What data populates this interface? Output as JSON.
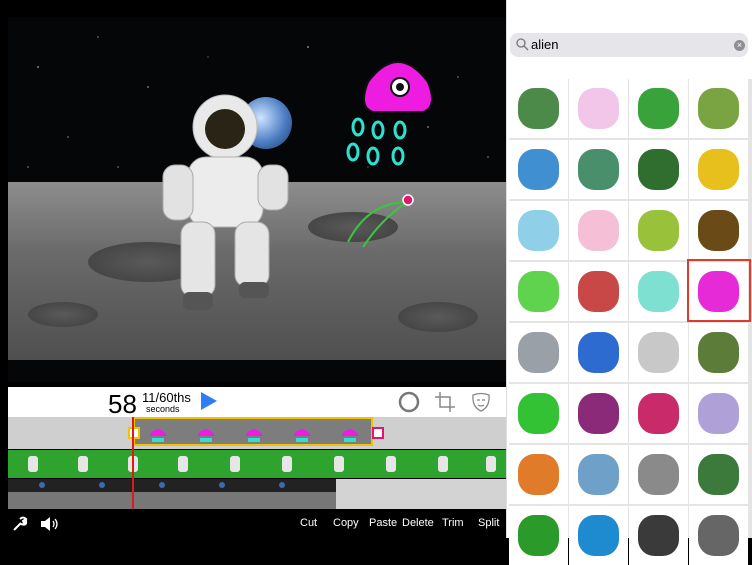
{
  "timeline": {
    "time_seconds": "58",
    "time_fraction": "11/60ths",
    "time_unit": "seconds"
  },
  "bottombar": {
    "buttons": [
      "Cut",
      "Copy",
      "Paste",
      "Delete",
      "Trim",
      "Split"
    ]
  },
  "search": {
    "query": "alien"
  },
  "results": {
    "count": 32,
    "selected_index": 15
  },
  "colors": {
    "accent": "#2f7df6",
    "selection": "#f2c200",
    "playhead": "#e01818",
    "track_green": "#2ea32e",
    "highlight": "#e23a2a"
  },
  "icons": [
    "wrench-icon",
    "speaker-icon",
    "play-icon",
    "circle-tool-icon",
    "crop-icon",
    "mask-icon",
    "search-icon",
    "clear-icon",
    "expand-icon"
  ]
}
